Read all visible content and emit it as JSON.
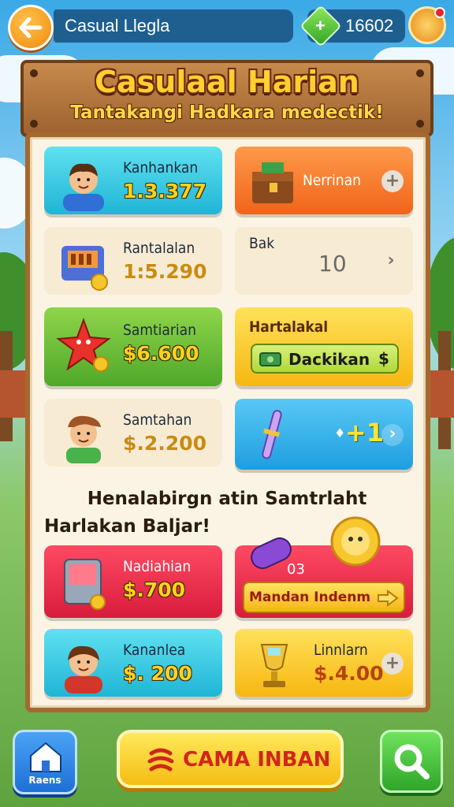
{
  "topbar": {
    "title": "Casual Llegla",
    "gems": "16602"
  },
  "board": {
    "title": "Casulaal Harian",
    "subtitle": "Tantakangi Hadkara medectik!"
  },
  "cards": {
    "c1": {
      "label": "Kanhankan",
      "value": "1.3.377"
    },
    "c2": {
      "label": "Nerrinan"
    },
    "c3": {
      "label": "Rantalalan",
      "value": "1:5.290"
    },
    "c4": {
      "label": "Bak",
      "value": "10"
    },
    "c5": {
      "label": "Samtiarian",
      "value": "$6.600"
    },
    "c6": {
      "label": "Hartalakal",
      "button": "Dackikan",
      "button_symbol": "$"
    },
    "c7": {
      "label": "Samtahan",
      "value": "$.2.200"
    },
    "c8": {
      "value": "+1",
      "symbol": "♦"
    },
    "c9": {
      "label": "Nadiahian",
      "value": "$.700"
    },
    "c10": {
      "badge": "03",
      "button": "Mandan Indenm"
    },
    "c11": {
      "label": "Kananlea",
      "value": "$. 200"
    },
    "c12": {
      "label": "Linnlarn",
      "value": "$.4.00"
    }
  },
  "section": {
    "heading": "Henalabirgn atin Samtrlaht",
    "subheading": "Harlakan Baljar!"
  },
  "bottom": {
    "home_label": "Raens",
    "play_label": "CAMA INBAN"
  },
  "colors": {
    "accent_yellow": "#ffd21f",
    "wood": "#a5692f",
    "red": "#d81c3c"
  }
}
